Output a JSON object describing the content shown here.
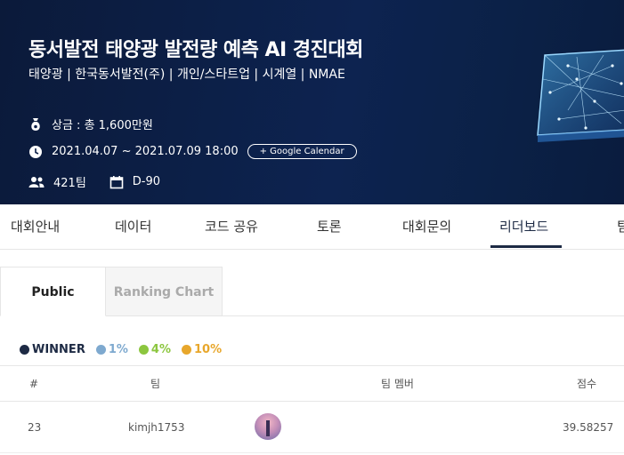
{
  "hero": {
    "title": "동서발전 태양광 발전량 예측 AI 경진대회",
    "subtitle": "태양광 | 한국동서발전(주) | 개인/스타트업 | 시계열 | NMAE",
    "prize": "상금 : 총 1,600만원",
    "period": "2021.04.07 ~ 2021.07.09 18:00",
    "calendar_button": "+ Google Calendar",
    "teams": "421팀",
    "dday": "D-90"
  },
  "tabs": [
    {
      "label": "대회안내"
    },
    {
      "label": "데이터"
    },
    {
      "label": "코드 공유"
    },
    {
      "label": "토론"
    },
    {
      "label": "대회문의"
    },
    {
      "label": "리더보드"
    },
    {
      "label": "팀"
    }
  ],
  "active_tab": "리더보드",
  "subtabs": {
    "public": "Public",
    "ranking_chart": "Ranking Chart"
  },
  "legend": [
    {
      "label": "WINNER",
      "color": "#1d2a44"
    },
    {
      "label": "1%",
      "color": "#7ea9cf"
    },
    {
      "label": "4%",
      "color": "#8cc63f"
    },
    {
      "label": "10%",
      "color": "#e8a72c"
    }
  ],
  "table": {
    "headers": {
      "rank": "#",
      "team": "팀",
      "members": "팀 멤버",
      "score": "점수"
    },
    "rows": [
      {
        "rank": "23",
        "team": "kimjh1753",
        "score": "39.58257"
      }
    ]
  }
}
